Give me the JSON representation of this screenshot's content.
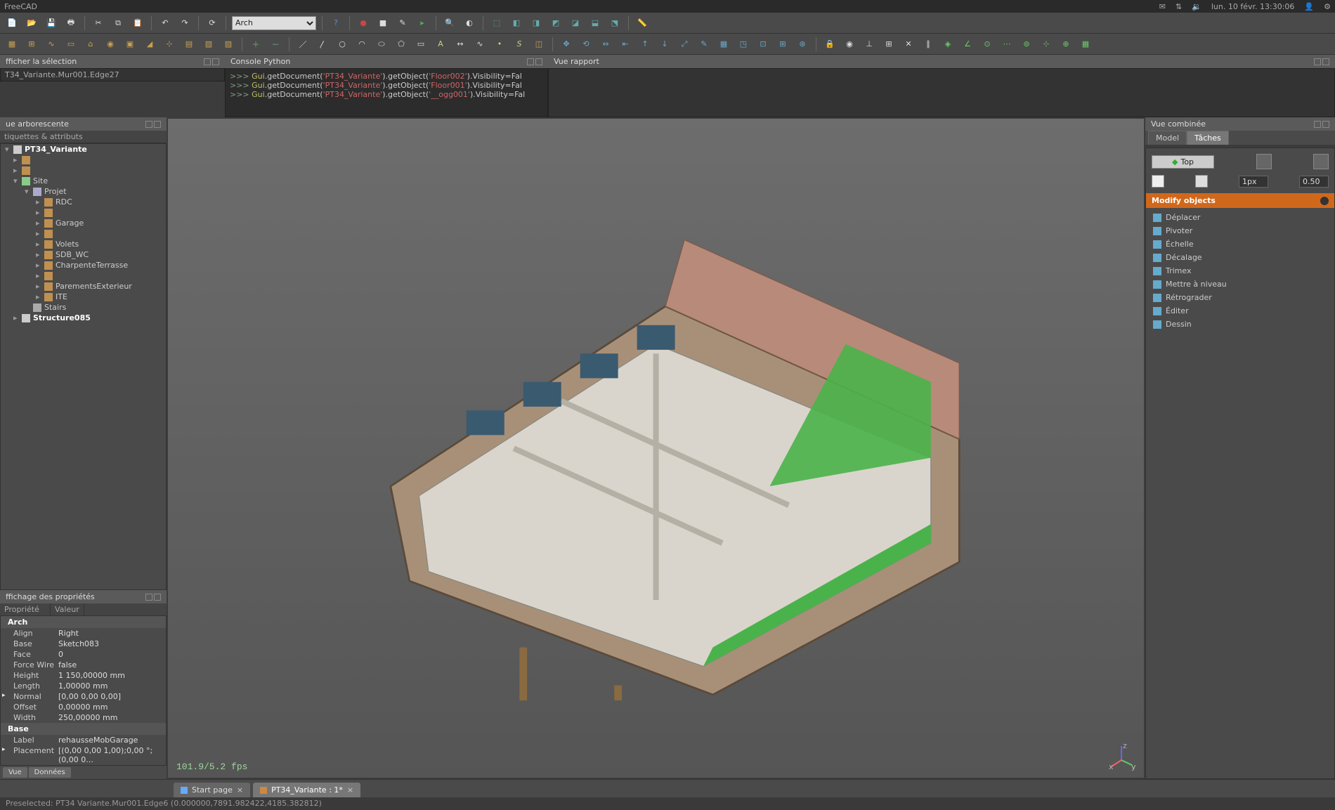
{
  "app": {
    "title": "FreeCAD"
  },
  "sysbar": {
    "datetime": "lun. 10 févr. 13:30:06"
  },
  "workbench": {
    "selected": "Arch"
  },
  "panels": {
    "selection_title": "fficher la sélection",
    "selection_value": "T34_Variante.Mur001.Edge27",
    "tree_title": "ue arborescente",
    "tree_header": "tiquettes & attributs",
    "props_title": "ffichage des propriétés",
    "props_col1": "Propriété",
    "props_col2": "Valeur",
    "console_title": "Console Python",
    "report_title": "Vue rapport",
    "combo_title": "Vue combinée"
  },
  "tree": {
    "root": "PT34_Variante",
    "site": "Site",
    "project": "Projet",
    "items": [
      "RDC",
      "",
      "Garage",
      "",
      "Volets",
      "SDB_WC",
      "CharpenteTerrasse",
      "",
      "ParementsExterieur",
      "ITE"
    ],
    "stairs": "Stairs",
    "structure": "Structure085"
  },
  "props": {
    "section1": "Arch",
    "rows1": [
      {
        "k": "Align",
        "v": "Right"
      },
      {
        "k": "Base",
        "v": "Sketch083"
      },
      {
        "k": "Face",
        "v": "0"
      },
      {
        "k": "Force Wire",
        "v": "false"
      },
      {
        "k": "Height",
        "v": "1 150,00000 mm"
      },
      {
        "k": "Length",
        "v": "1,00000 mm"
      },
      {
        "k": "Normal",
        "v": "[0,00 0,00 0,00]",
        "arrow": true
      },
      {
        "k": "Offset",
        "v": "0,00000 mm"
      },
      {
        "k": "Width",
        "v": "250,00000 mm"
      }
    ],
    "section2": "Base",
    "rows2": [
      {
        "k": "Label",
        "v": "rehausseMobGarage"
      },
      {
        "k": "Placement",
        "v": "[(0,00 0,00 1,00);0,00 °;(0,00 0...",
        "arrow": true
      }
    ]
  },
  "console_lines": [
    {
      "p": ">>> ",
      "a": "Gui",
      "b": ".getDocument(",
      "c": "'PT34_Variante'",
      "d": ").getObject(",
      "e": "'Floor002'",
      "f": ").Visibility=Fal"
    },
    {
      "p": ">>> ",
      "a": "Gui",
      "b": ".getDocument(",
      "c": "'PT34_Variante'",
      "d": ").getObject(",
      "e": "'Floor001'",
      "f": ").Visibility=Fal"
    },
    {
      "p": ">>> ",
      "a": "Gui",
      "b": ".getDocument(",
      "c": "'PT34_Variante'",
      "d": ").getObject(",
      "e": "'__ogg001'",
      "f": ").Visibility=Fal"
    }
  ],
  "viewport": {
    "fps": "101.9/5.2 fps"
  },
  "view_tabs": {
    "a": "Vue",
    "b": "Données"
  },
  "doc_tabs": {
    "start": "Start page",
    "doc": "PT34_Variante : 1*"
  },
  "statusbar": "Preselected: PT34 Variante.Mur001.Edge6 (0.000000,7891.982422,4185.382812)",
  "combo": {
    "tab_model": "Model",
    "tab_tasks": "Tâches",
    "top_btn": "Top",
    "spin1": "1px",
    "spin2": "0.50",
    "modify_title": "Modify objects",
    "items": [
      {
        "label": "Déplacer",
        "name": "move"
      },
      {
        "label": "Pivoter",
        "name": "rotate"
      },
      {
        "label": "Échelle",
        "name": "scale"
      },
      {
        "label": "Décalage",
        "name": "offset"
      },
      {
        "label": "Trimex",
        "name": "trimex"
      },
      {
        "label": "Mettre à niveau",
        "name": "upgrade"
      },
      {
        "label": "Rétrograder",
        "name": "downgrade"
      },
      {
        "label": "Éditer",
        "name": "edit"
      },
      {
        "label": "Dessin",
        "name": "drawing"
      }
    ]
  }
}
